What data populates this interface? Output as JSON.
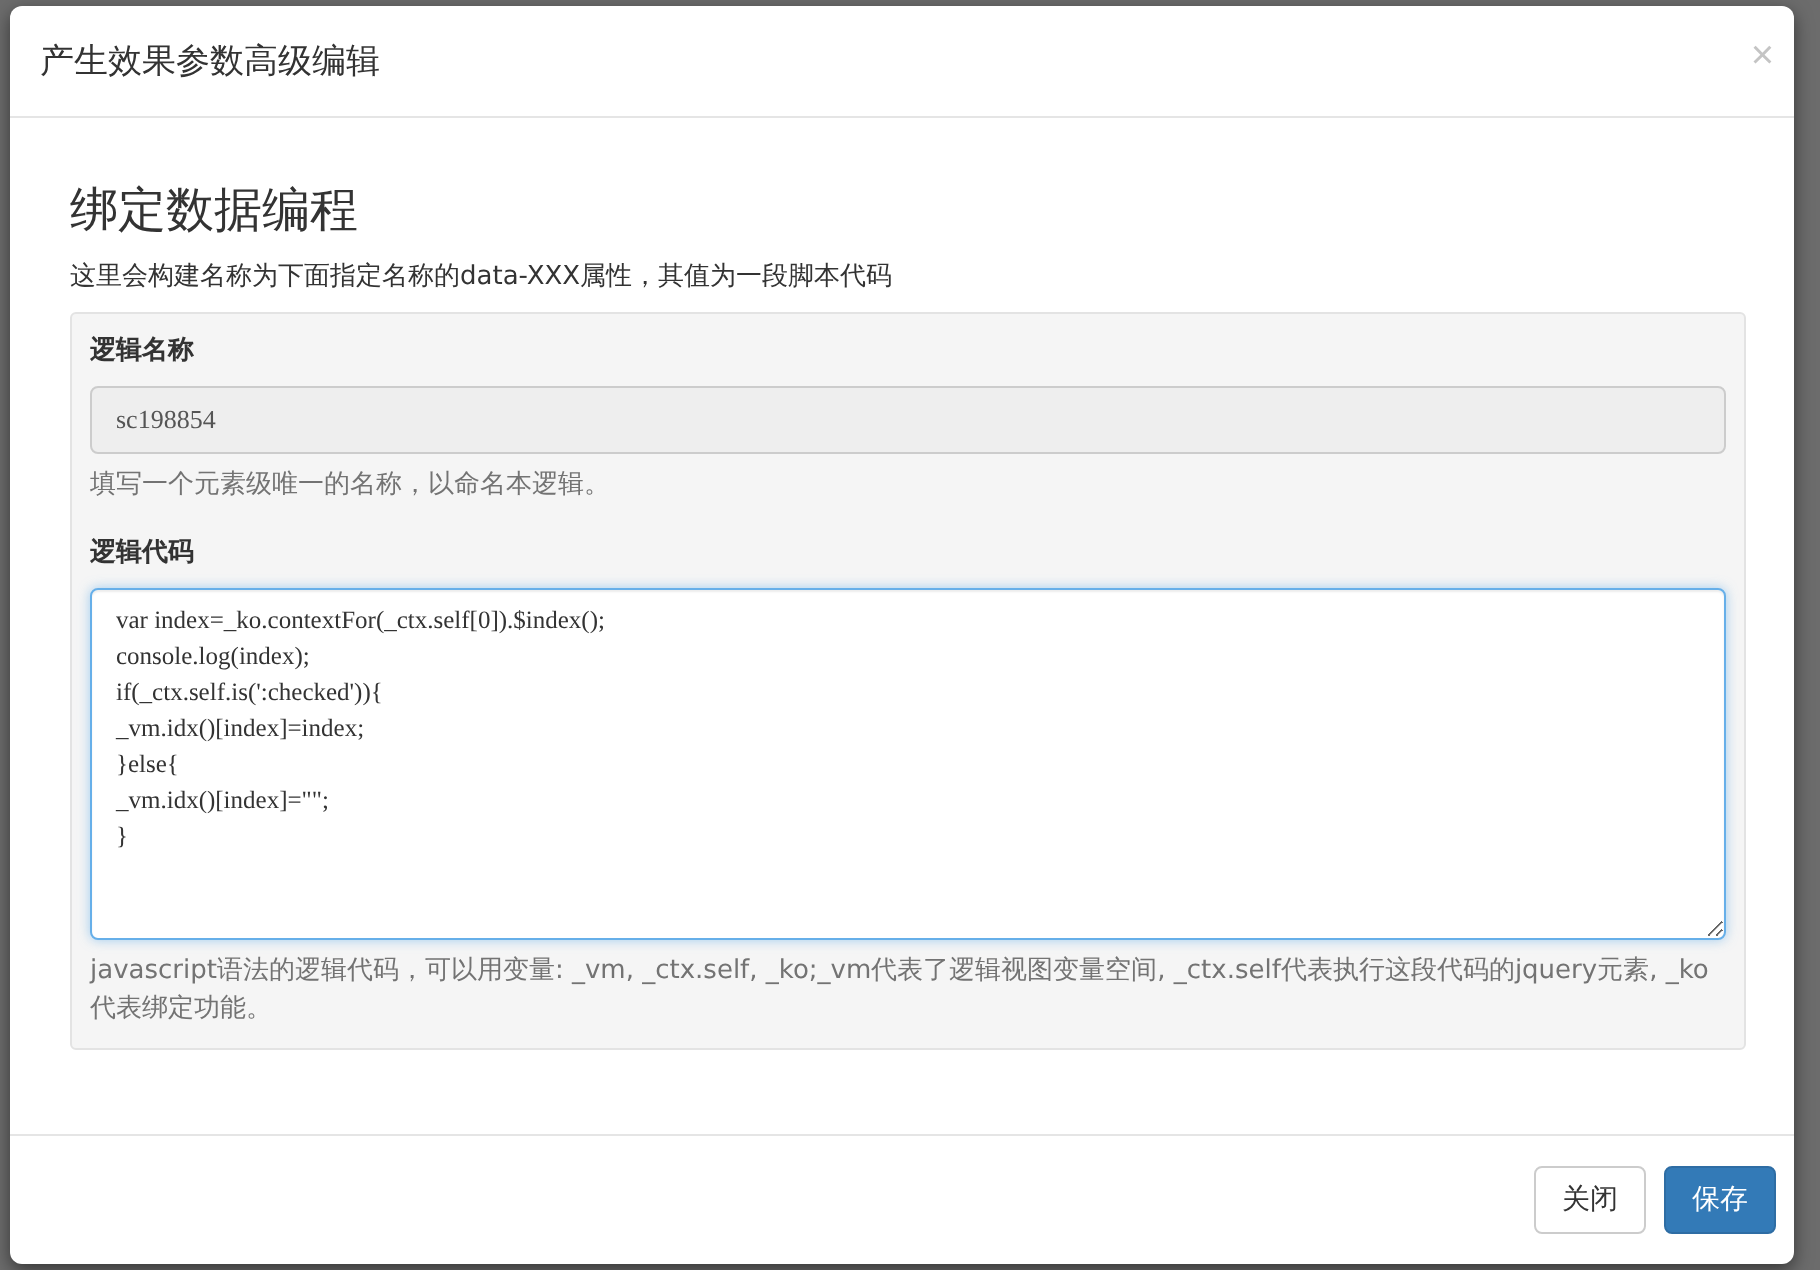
{
  "dialog": {
    "title": "产生效果参数高级编辑",
    "close": "×"
  },
  "section": {
    "heading": "绑定数据编程",
    "description": "这里会构建名称为下面指定名称的data-XXX属性，其值为一段脚本代码"
  },
  "fields": [
    {
      "kind": "input",
      "label": "逻辑名称",
      "value": "sc198854",
      "disabled": true,
      "help": "填写一个元素级唯一的名称，以命名本逻辑。"
    },
    {
      "kind": "textarea",
      "label": "逻辑代码",
      "focused": true,
      "lines": [
        "var index=_ko.contextFor(_ctx.self[0]).$index();",
        "console.log(index);",
        "if(_ctx.self.is(':checked')){",
        "_vm.idx()[index]=index;",
        "}else{",
        "_vm.idx()[index]=\"\";",
        "}"
      ],
      "help": "javascript语法的逻辑代码，可以用变量: _vm, _ctx.self, _ko;_vm代表了逻辑视图变量空间, _ctx.self代表执行这段代码的jquery元素, _ko代表绑定功能。"
    }
  ],
  "buttons": [
    {
      "label": "关闭",
      "kind": "default"
    },
    {
      "label": "保存",
      "kind": "primary"
    }
  ]
}
